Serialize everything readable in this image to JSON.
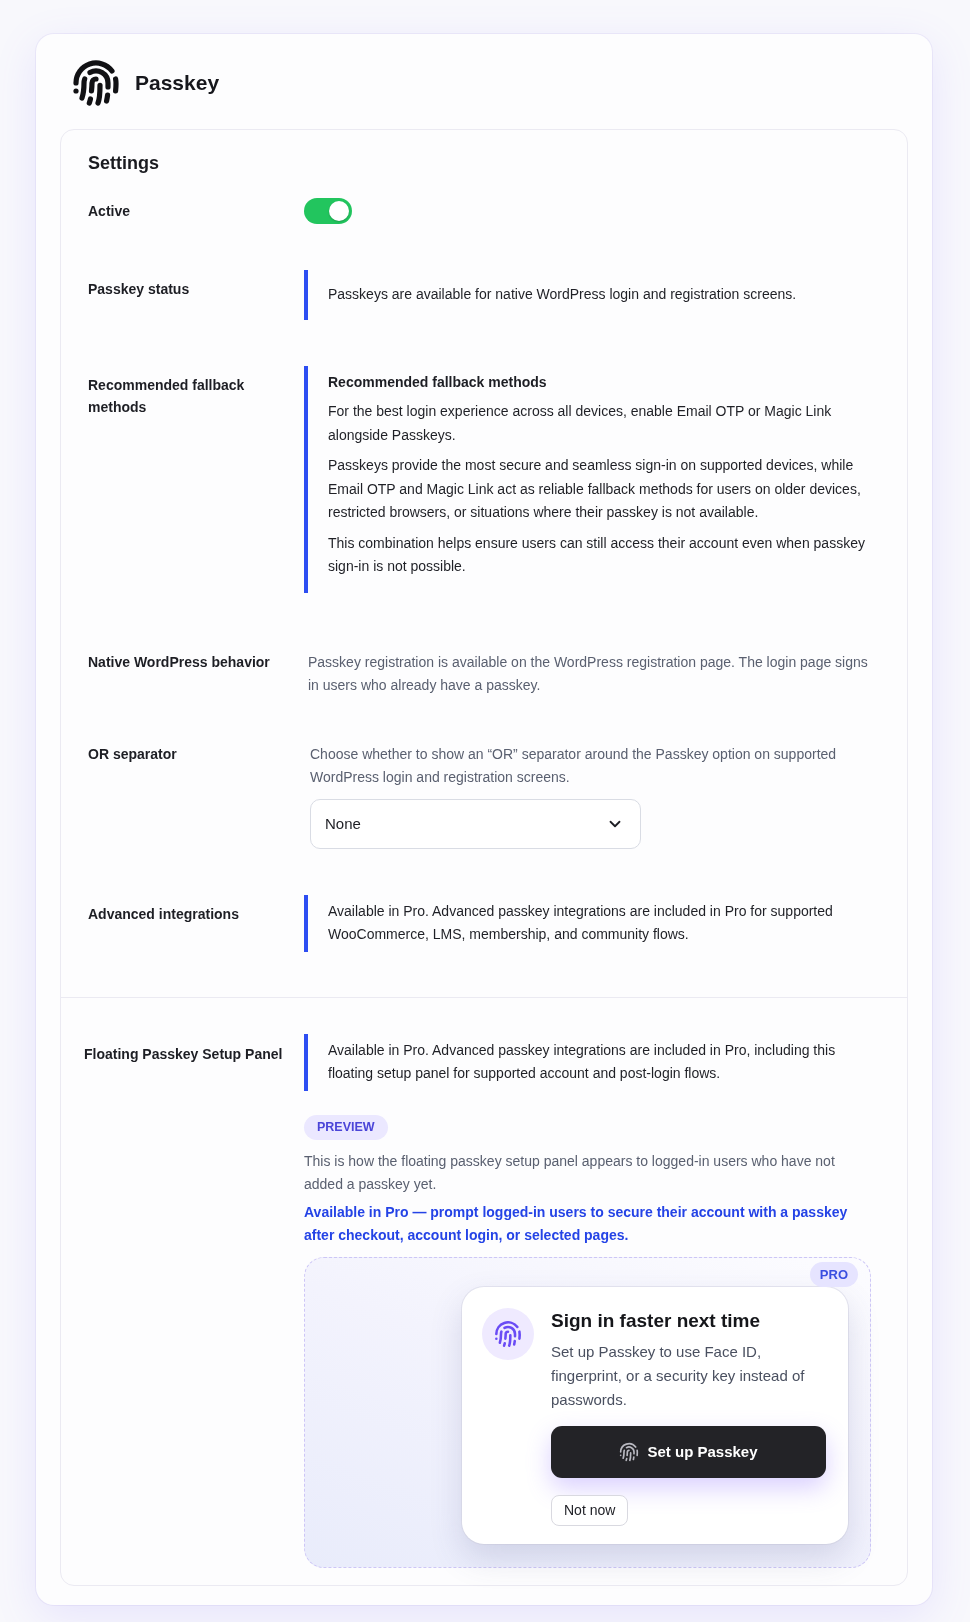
{
  "header": {
    "title": "Passkey"
  },
  "settings": {
    "title": "Settings",
    "rows": [
      {
        "kind": "toggle",
        "label": "Active",
        "on": true
      },
      {
        "kind": "notice",
        "label": "Passkey status",
        "paragraphs": [
          "Passkeys are available for native WordPress login and registration screens."
        ]
      },
      {
        "kind": "notice",
        "label": "Recommended fallback methods",
        "heading": "Recommended fallback methods",
        "paragraphs": [
          "For the best login experience across all devices, enable Email OTP or Magic Link alongside Passkeys.",
          "Passkeys provide the most secure and seamless sign-in on supported devices, while Email OTP and Magic Link act as reliable fallback methods for users on older devices, restricted browsers, or situations where their passkey is not available.",
          "This combination helps ensure users can still access their account even when passkey sign-in is not possible."
        ]
      },
      {
        "kind": "text",
        "label": "Native WordPress behavior",
        "text": "Passkey registration is available on the WordPress registration page. The login page signs in users who already have a passkey."
      },
      {
        "kind": "select",
        "label": "OR separator",
        "description": "Choose whether to show an “OR” separator around the Passkey option on supported WordPress login and registration screens.",
        "value": "None"
      },
      {
        "kind": "notice",
        "label": "Advanced integrations",
        "paragraphs": [
          "Available in Pro. Advanced passkey integrations are included in Pro for supported WooCommerce, LMS, membership, and community flows."
        ]
      }
    ]
  },
  "floating_panel": {
    "label": "Floating Passkey Setup Panel",
    "notice": {
      "paragraphs": [
        "Available in Pro. Advanced passkey integrations are included in Pro, including this floating setup panel for supported account and post-login flows."
      ]
    },
    "badge": "PREVIEW",
    "description": "This is how the floating passkey setup panel appears to logged-in users who have not added a passkey yet.",
    "pro_note": "Available in Pro — prompt logged-in users to secure their account with a passkey after checkout, account login, or selected pages.",
    "preview": {
      "badge": "PRO",
      "title": "Sign in faster next time",
      "text": "Set up Passkey to use Face ID, fingerprint, or a security key instead of passwords.",
      "primary_button": "Set up Passkey",
      "secondary_button": "Not now"
    }
  }
}
